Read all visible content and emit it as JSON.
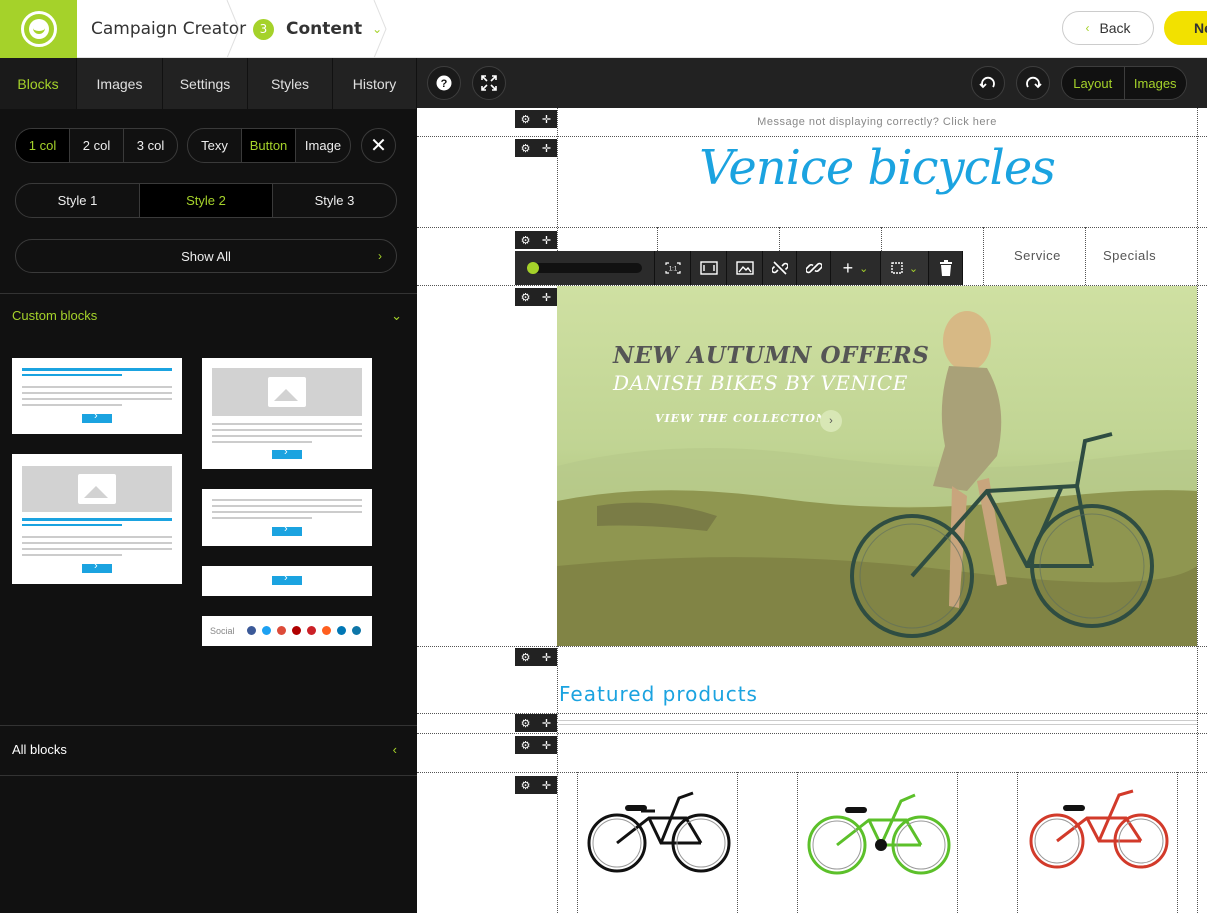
{
  "header": {
    "app_title": "Campaign Creator",
    "step_number": "3",
    "step_label": "Content",
    "back_label": "Back",
    "next_label": "Ne",
    "accent_color": "#a5d22a"
  },
  "left_panel": {
    "tabs": [
      {
        "label": "Blocks",
        "active": true
      },
      {
        "label": "Images",
        "active": false
      },
      {
        "label": "Settings",
        "active": false
      },
      {
        "label": "Styles",
        "active": false
      },
      {
        "label": "History",
        "active": false
      }
    ],
    "columns": [
      {
        "label": "1 col",
        "active": true
      },
      {
        "label": "2 col",
        "active": false
      },
      {
        "label": "3 col",
        "active": false
      }
    ],
    "content_types": [
      {
        "label": "Texy",
        "active": false
      },
      {
        "label": "Button",
        "active": true
      },
      {
        "label": "Image",
        "active": false
      }
    ],
    "styles": [
      {
        "label": "Style 1",
        "active": false
      },
      {
        "label": "Style 2",
        "active": true
      },
      {
        "label": "Style 3",
        "active": false
      }
    ],
    "show_all_label": "Show All",
    "custom_blocks_label": "Custom blocks",
    "social_label": "Social",
    "social_colors": [
      "#3b5998",
      "#1da1f2",
      "#dd4b39",
      "#b00000",
      "#cb2027",
      "#ff5f1f",
      "#0077b5",
      "#0e76a8"
    ],
    "all_blocks_label": "All blocks"
  },
  "canvas_toolbar": {
    "help_icon": "question-icon",
    "fullscreen_icon": "expand-icon",
    "undo_icon": "undo-icon",
    "redo_icon": "redo-icon",
    "view_modes": [
      "Layout",
      "Images"
    ]
  },
  "email": {
    "preheader": "Message not displaying correctly? Click here",
    "brand": "Venice bicycles",
    "nav": [
      "Service",
      "Specials"
    ],
    "hero": {
      "title": "NEW AUTUMN OFFERS",
      "subtitle": "DANISH BIKES BY VENICE",
      "cta": "VIEW THE COLLECTION"
    },
    "featured_heading": "Featured products",
    "products": [
      {
        "name": "black-bike",
        "color": "#111111"
      },
      {
        "name": "green-bike",
        "color": "#5cc02a"
      },
      {
        "name": "red-bike",
        "color": "#d23a2a"
      }
    ]
  }
}
